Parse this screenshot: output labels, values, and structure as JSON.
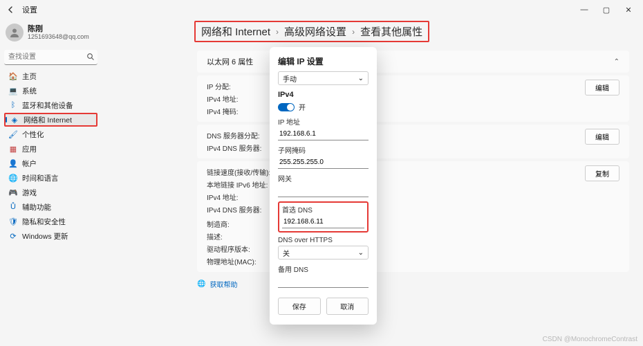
{
  "window": {
    "title": "设置",
    "watermark": "CSDN @MonochromeContrast"
  },
  "user": {
    "name": "陈刚",
    "email": "1251693648@qq.com"
  },
  "search": {
    "placeholder": "查找设置"
  },
  "sidebar": [
    {
      "label": "主页",
      "icon": "🏠",
      "color": "#0067c0"
    },
    {
      "label": "系统",
      "icon": "💻",
      "color": "#555"
    },
    {
      "label": "蓝牙和其他设备",
      "icon": "ᛒ",
      "color": "#0067c0"
    },
    {
      "label": "网络和 Internet",
      "icon": "◈",
      "color": "#0067c0",
      "active": true,
      "highlight": true
    },
    {
      "label": "个性化",
      "icon": "🖌",
      "color": "#0067c0"
    },
    {
      "label": "应用",
      "icon": "▦",
      "color": "#c23f3f"
    },
    {
      "label": "帐户",
      "icon": "👤",
      "color": "#6b6b6b"
    },
    {
      "label": "时间和语言",
      "icon": "🌐",
      "color": "#0067c0"
    },
    {
      "label": "游戏",
      "icon": "🎮",
      "color": "#555"
    },
    {
      "label": "辅助功能",
      "icon": "Ů",
      "color": "#0067c0"
    },
    {
      "label": "隐私和安全性",
      "icon": "🛡",
      "color": "#0067c0"
    },
    {
      "label": "Windows 更新",
      "icon": "⟳",
      "color": "#0067c0"
    }
  ],
  "breadcrumb": [
    "网络和 Internet",
    "高级网络设置",
    "查看其他属性"
  ],
  "adapter": {
    "header": "以太网 6 属性"
  },
  "sections": [
    {
      "labels": [
        "IP 分配:",
        "IPv4 地址:",
        "IPv4 掩码:"
      ],
      "button": "编辑"
    },
    {
      "labels": [
        "DNS 服务器分配:",
        "IPv4 DNS 服务器:"
      ],
      "button": "编辑"
    },
    {
      "labels": [
        "链接速度(接收/传输):",
        "本地链接 IPv6 地址:",
        "IPv4 地址:",
        "IPv4 DNS 服务器:",
        "",
        "制造商:",
        "描述:",
        "驱动程序版本:",
        "物理地址(MAC):"
      ],
      "button": "复制"
    }
  ],
  "help": {
    "label": "获取帮助"
  },
  "dialog": {
    "title": "编辑 IP 设置",
    "mode": "手动",
    "ipv4": {
      "enabled": true,
      "toggle_label": "开"
    },
    "ip": {
      "label": "IP 地址",
      "value": "192.168.6.1"
    },
    "mask": {
      "label": "子网掩码",
      "value": "255.255.255.0"
    },
    "gateway": {
      "label": "网关",
      "value": ""
    },
    "dns1": {
      "label": "首选 DNS",
      "value": "192.168.6.11"
    },
    "dnshttps": {
      "label": "DNS over HTTPS",
      "value": "关"
    },
    "dns2": {
      "label": "备用 DNS",
      "value": ""
    },
    "save": "保存",
    "cancel": "取消"
  }
}
